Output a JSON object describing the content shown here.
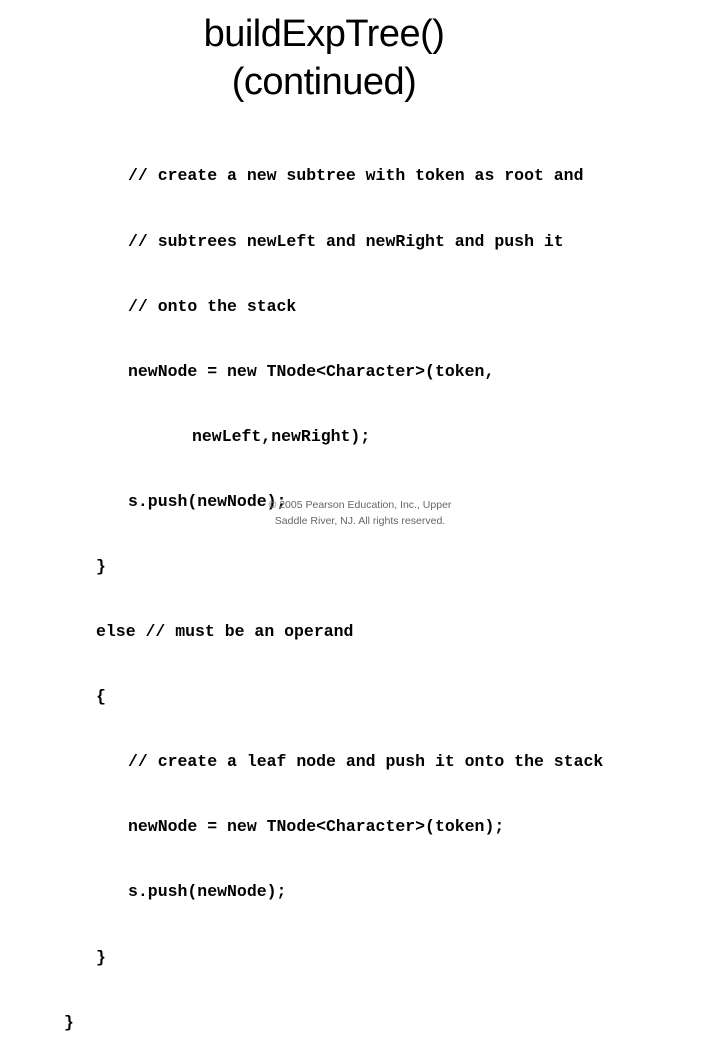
{
  "slide": {
    "title_lines": [
      "buildExpTree()",
      "(continued)"
    ],
    "code_lines": [
      {
        "indent": 128,
        "text": "// create a new subtree with token as root and"
      },
      {
        "indent": 128,
        "text": "// subtrees newLeft and newRight and push it"
      },
      {
        "indent": 128,
        "text": "// onto the stack"
      },
      {
        "indent": 128,
        "text": "newNode = new TNode<Character>(token,"
      },
      {
        "indent": 192,
        "text": "newLeft,newRight);"
      },
      {
        "indent": 128,
        "text": "s.push(newNode);"
      },
      {
        "indent": 96,
        "text": "}"
      },
      {
        "indent": 96,
        "text": "else // must be an operand"
      },
      {
        "indent": 96,
        "text": "{"
      },
      {
        "indent": 128,
        "text": "// create a leaf node and push it onto the stack"
      },
      {
        "indent": 128,
        "text": "newNode = new TNode<Character>(token);"
      },
      {
        "indent": 128,
        "text": "s.push(newNode);"
      },
      {
        "indent": 96,
        "text": "}"
      },
      {
        "indent": 64,
        "text": "}"
      }
    ],
    "footer_lines": [
      "© 2005 Pearson Education, Inc., Upper",
      "Saddle River, NJ.  All rights reserved."
    ]
  }
}
